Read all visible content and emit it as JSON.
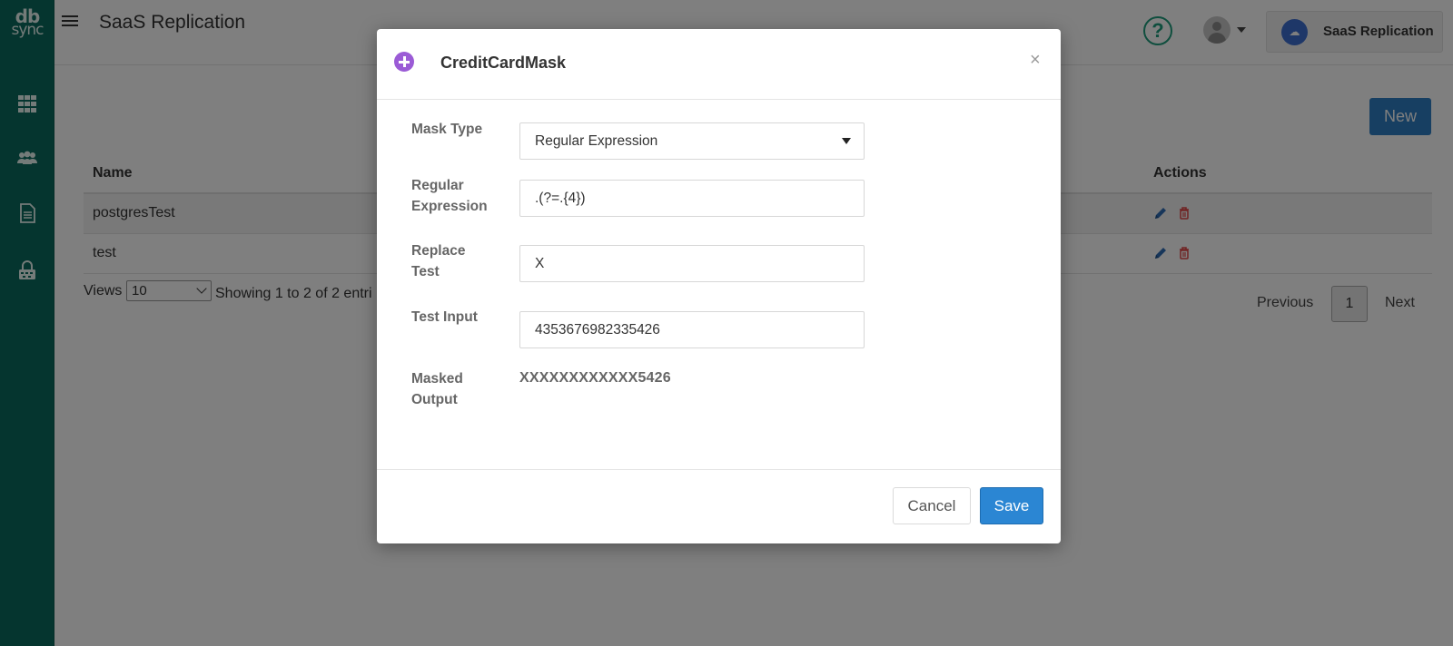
{
  "brand": {
    "logo_top": "db",
    "logo_bottom": "sync",
    "rail_color": "#0b6b5e"
  },
  "header": {
    "title": "SaaS Replication",
    "account_name": "SaaS Replication"
  },
  "rail_icons": [
    "dashboard-grid-icon",
    "users-icon",
    "document-icon",
    "lock-icon"
  ],
  "toolbar": {
    "new_label": "New"
  },
  "table": {
    "columns": [
      "Name",
      "Actions"
    ],
    "rows": [
      {
        "name": "postgresTest"
      },
      {
        "name": "test"
      }
    ]
  },
  "pagination": {
    "views_label": "Views",
    "views_value": "10",
    "showing": "Showing 1 to 2 of 2 entri",
    "previous": "Previous",
    "page": "1",
    "next": "Next"
  },
  "modal": {
    "title": "CreditCardMask",
    "close": "×",
    "fields": {
      "mask_type_label": "Mask Type",
      "mask_type_value": "Regular Expression",
      "regex_label_1": "Regular",
      "regex_label_2": "Expression",
      "regex_value": ".(?=.{4})",
      "replace_label_1": "Replace",
      "replace_label_2": "Test",
      "replace_value": "X",
      "test_input_label": "Test Input",
      "test_input_value": "4353676982335426",
      "masked_label_1": "Masked",
      "masked_label_2": "Output",
      "masked_value": "XXXXXXXXXXXX5426"
    },
    "cancel_label": "Cancel",
    "save_label": "Save"
  },
  "colors": {
    "primary": "#2b86d3",
    "accent_purple": "#9b5bd6",
    "help_green": "#1f9d7d",
    "delete_red": "#e04646",
    "edit_blue": "#2f6db5"
  }
}
